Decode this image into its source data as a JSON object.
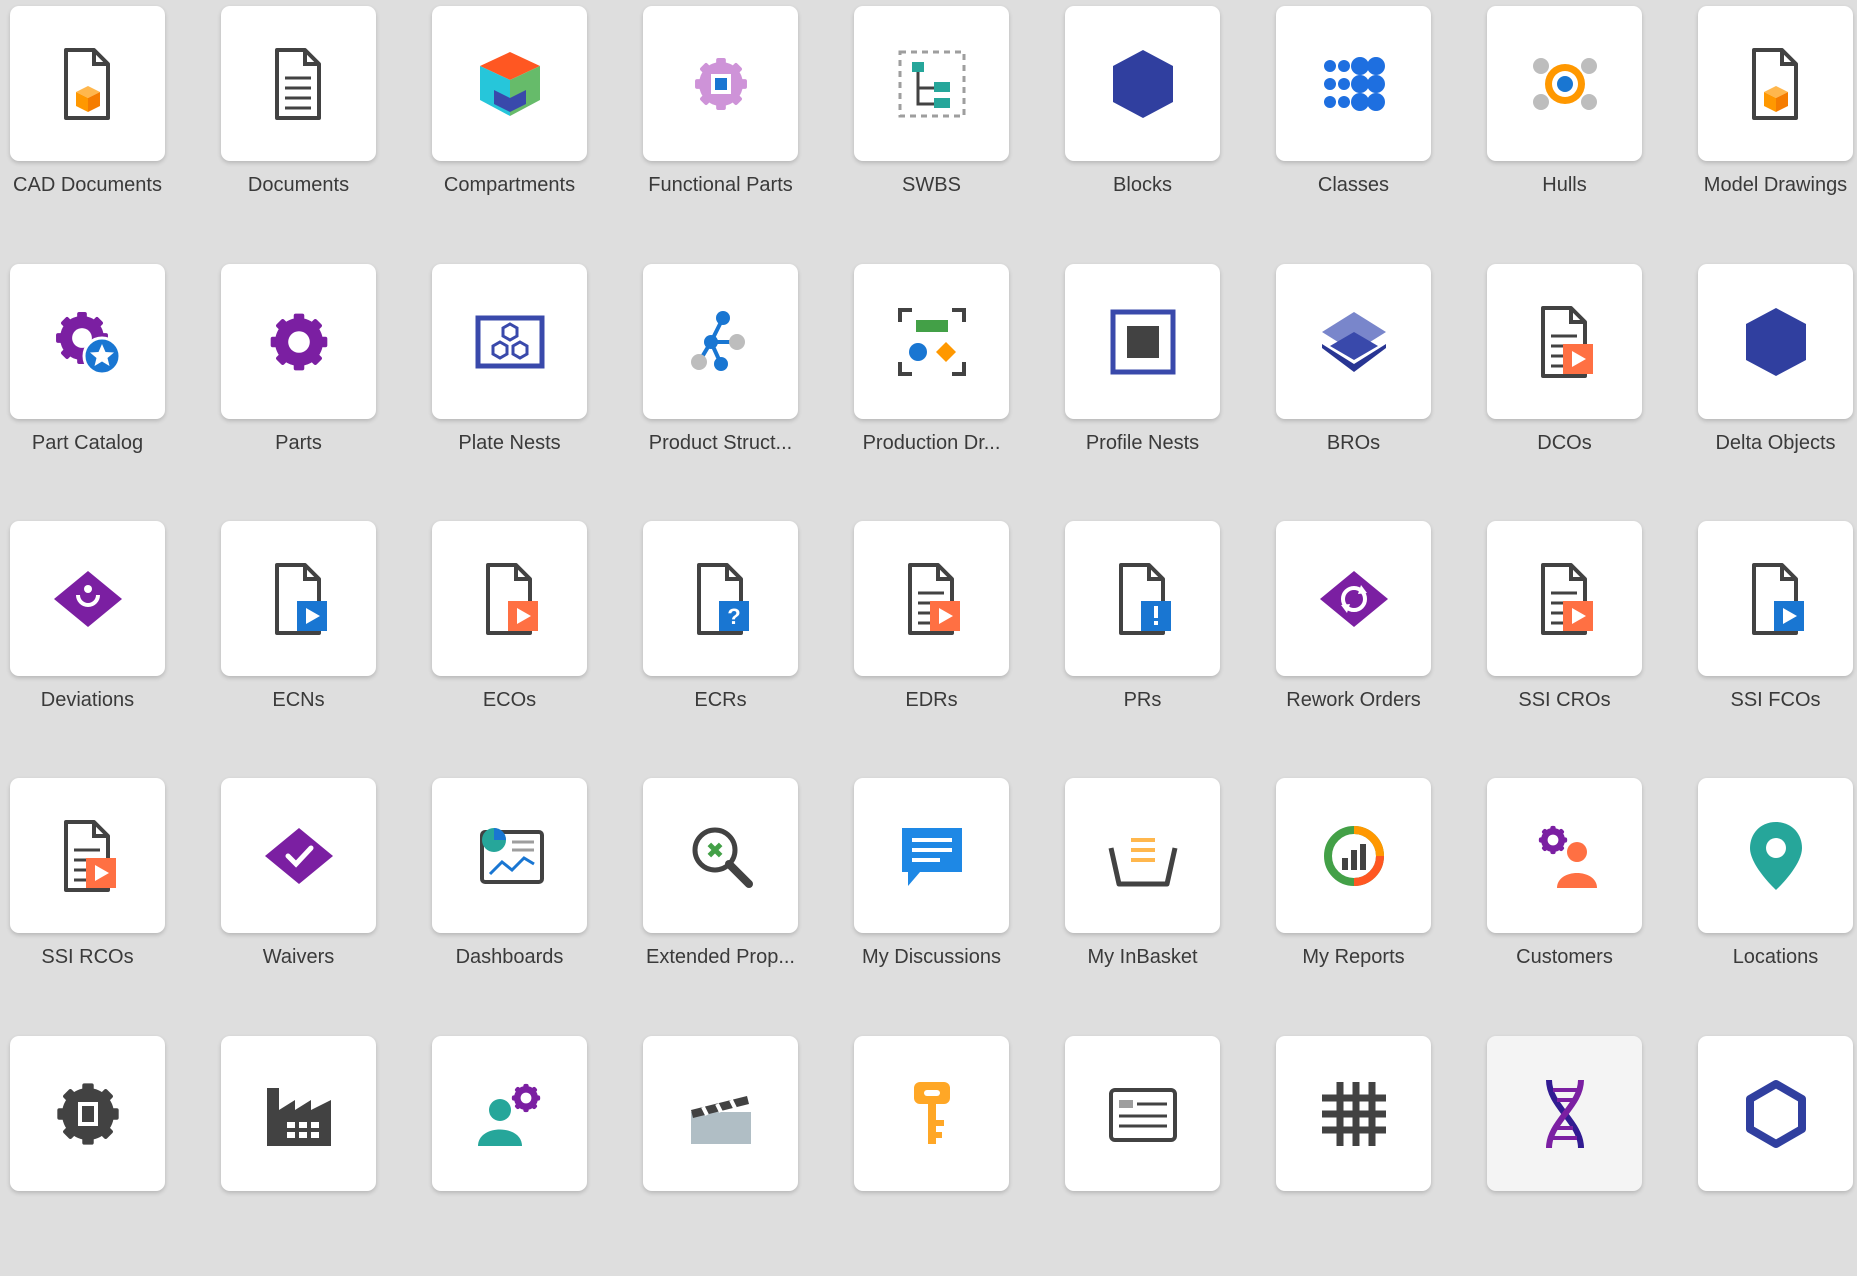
{
  "tiles": [
    {
      "label": "CAD Documents",
      "icon": "cad-document-icon"
    },
    {
      "label": "Documents",
      "icon": "document-icon"
    },
    {
      "label": "Compartments",
      "icon": "compartment-cube-icon"
    },
    {
      "label": "Functional Parts",
      "icon": "functional-part-gear-icon"
    },
    {
      "label": "SWBS",
      "icon": "swbs-tree-icon"
    },
    {
      "label": "Blocks",
      "icon": "block-hexagon-icon"
    },
    {
      "label": "Classes",
      "icon": "classes-dots-icon"
    },
    {
      "label": "Hulls",
      "icon": "hull-target-icon"
    },
    {
      "label": "Model Drawings",
      "icon": "model-drawing-icon"
    },
    {
      "label": "Part Catalog",
      "icon": "part-catalog-icon"
    },
    {
      "label": "Parts",
      "icon": "part-gear-icon"
    },
    {
      "label": "Plate Nests",
      "icon": "plate-nest-icon"
    },
    {
      "label": "Product Struct...",
      "icon": "product-structure-icon"
    },
    {
      "label": "Production Dr...",
      "icon": "production-drawing-icon"
    },
    {
      "label": "Profile Nests",
      "icon": "profile-nest-icon"
    },
    {
      "label": "BROs",
      "icon": "bro-layers-icon"
    },
    {
      "label": "DCOs",
      "icon": "dco-document-icon"
    },
    {
      "label": "Delta Objects",
      "icon": "delta-object-hexagon-icon"
    },
    {
      "label": "Deviations",
      "icon": "deviation-diamond-icon"
    },
    {
      "label": "ECNs",
      "icon": "ecn-document-icon"
    },
    {
      "label": "ECOs",
      "icon": "eco-document-icon"
    },
    {
      "label": "ECRs",
      "icon": "ecr-document-icon"
    },
    {
      "label": "EDRs",
      "icon": "edr-document-icon"
    },
    {
      "label": "PRs",
      "icon": "pr-document-icon"
    },
    {
      "label": "Rework Orders",
      "icon": "rework-order-diamond-icon"
    },
    {
      "label": "SSI CROs",
      "icon": "ssi-cro-document-icon"
    },
    {
      "label": "SSI FCOs",
      "icon": "ssi-fco-document-icon"
    },
    {
      "label": "SSI RCOs",
      "icon": "ssi-rco-document-icon"
    },
    {
      "label": "Waivers",
      "icon": "waiver-diamond-icon"
    },
    {
      "label": "Dashboards",
      "icon": "dashboard-icon"
    },
    {
      "label": "Extended Prop...",
      "icon": "extended-property-magnifier-icon"
    },
    {
      "label": "My Discussions",
      "icon": "discussion-bubble-icon"
    },
    {
      "label": "My InBasket",
      "icon": "inbasket-icon"
    },
    {
      "label": "My Reports",
      "icon": "report-chart-icon"
    },
    {
      "label": "Customers",
      "icon": "customer-icon"
    },
    {
      "label": "Locations",
      "icon": "location-pin-icon"
    },
    {
      "label": "",
      "icon": "gear-chip-icon"
    },
    {
      "label": "",
      "icon": "factory-icon"
    },
    {
      "label": "",
      "icon": "user-gear-icon"
    },
    {
      "label": "",
      "icon": "clapperboard-icon"
    },
    {
      "label": "",
      "icon": "key-icon"
    },
    {
      "label": "",
      "icon": "form-card-icon"
    },
    {
      "label": "",
      "icon": "grid-hash-icon"
    },
    {
      "label": "",
      "icon": "dna-icon"
    },
    {
      "label": "",
      "icon": "hexagon-outline-icon"
    }
  ],
  "colors": {
    "background": "#dedede",
    "card": "#ffffff",
    "label": "#3a3a3a",
    "purple": "#7b1fa2",
    "navy": "#303f9f",
    "blue": "#1976d2",
    "orange": "#ff7043",
    "teal": "#26a69a",
    "gray": "#424242"
  }
}
